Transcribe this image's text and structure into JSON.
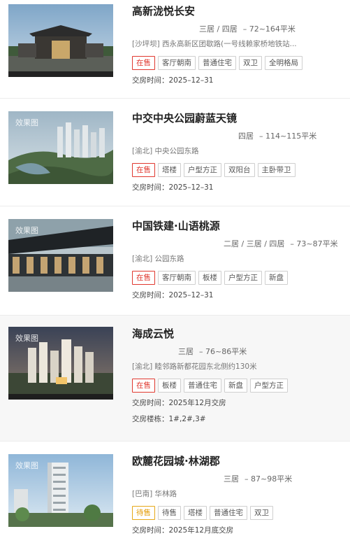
{
  "watermark": "效果图",
  "listings": [
    {
      "name": "高新泷悦长安",
      "rooms": "三居 / 四居",
      "area": "– 72~164平米",
      "address": "[沙坪坝] 西永高新区团歇路(一号线赖家桥地铁站...",
      "status": "在售",
      "tags": [
        "客厅朝南",
        "普通住宅",
        "双卫",
        "全明格局"
      ],
      "delivery": "交房时间：2025–12–31"
    },
    {
      "name": "中交中央公园蔚蓝天镜",
      "rooms": "四居",
      "area": "– 114~115平米",
      "address": "[渝北] 中央公园东路",
      "status": "在售",
      "tags": [
        "塔楼",
        "户型方正",
        "双阳台",
        "主卧带卫"
      ],
      "delivery": "交房时间：2025–12–31"
    },
    {
      "name": "中国铁建·山语桃源",
      "rooms": "二居 / 三居 / 四居",
      "area": "– 73~87平米",
      "address": "[渝北] 公园东路",
      "status": "在售",
      "tags": [
        "客厅朝南",
        "板楼",
        "户型方正",
        "新盘"
      ],
      "delivery": "交房时间：2025–12–31"
    },
    {
      "name": "海成云悦",
      "rooms": "三居",
      "area": "– 76~86平米",
      "address": "[渝北] 睦邻路新都花园东北侧约130米",
      "status": "在售",
      "tags": [
        "板楼",
        "普通住宅",
        "新盘",
        "户型方正"
      ],
      "delivery": "交房时间：2025年12月交房",
      "buildings": "交房楼栋：1#,2#,3#"
    },
    {
      "name": "欧麓花园城·林湖郡",
      "rooms": "三居",
      "area": "– 87~98平米",
      "address": "[巴南] 华林路",
      "status": "待售",
      "tags": [
        "待售",
        "塔楼",
        "普通住宅",
        "双卫"
      ],
      "delivery": "交房时间：2025年12月底交房"
    }
  ]
}
